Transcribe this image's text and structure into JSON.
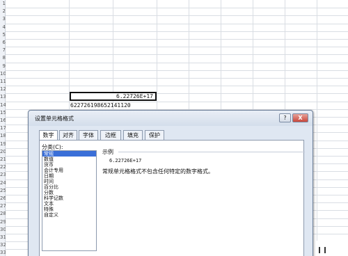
{
  "spreadsheet": {
    "row_numbers": [
      "1",
      "2",
      "3",
      "4",
      "5",
      "6",
      "7",
      "8",
      "9",
      "10",
      "11",
      "12",
      "13",
      "14",
      "15",
      "16",
      "17",
      "18",
      "19",
      "20",
      "21",
      "22",
      "23",
      "24",
      "25",
      "26",
      "27",
      "28",
      "29",
      "30",
      "31",
      "32",
      "33"
    ],
    "selected_cell_value": "6.22726E+17",
    "cell_below_value": "622726198652141120"
  },
  "dialog": {
    "title": "设置单元格格式",
    "help_label": "?",
    "close_label": "X",
    "tabs": [
      {
        "label": "数字",
        "active": true
      },
      {
        "label": "对齐",
        "active": false
      },
      {
        "label": "字体",
        "active": false
      },
      {
        "label": "边框",
        "active": false
      },
      {
        "label": "填充",
        "active": false
      },
      {
        "label": "保护",
        "active": false
      }
    ],
    "category_label": "分类(C):",
    "categories": [
      "常规",
      "数值",
      "货币",
      "会计专用",
      "日期",
      "时间",
      "百分比",
      "分数",
      "科学记数",
      "文本",
      "特殊",
      "自定义"
    ],
    "selected_category": "常规",
    "sample_label": "示例",
    "sample_value": "6.22726E+17",
    "description": "常规单元格格式不包含任何特定的数字格式。"
  },
  "colors": {
    "selection": "#3a6fd8",
    "dialog_bg": "#dfe7f2",
    "close_button": "#c8463a"
  }
}
